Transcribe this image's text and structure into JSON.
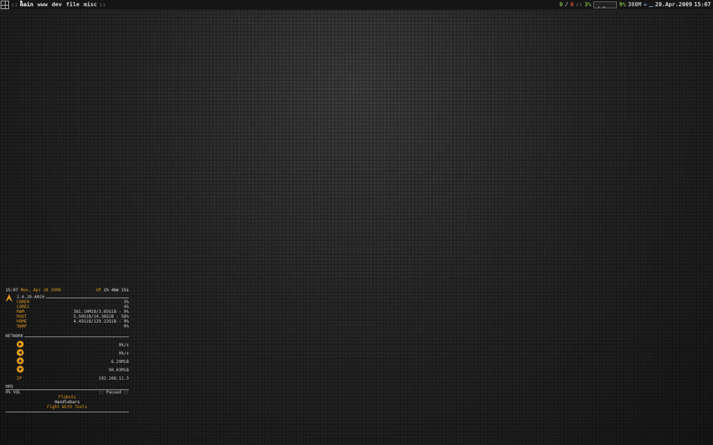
{
  "topbar": {
    "left_sep": "::",
    "tags": [
      {
        "label": "main",
        "active": true
      },
      {
        "label": "www",
        "active": false
      },
      {
        "label": "dev",
        "active": false
      },
      {
        "label": "file",
        "active": false
      },
      {
        "label": "misc",
        "active": false
      }
    ],
    "tags_end_sep": "::",
    "updates_a": "0",
    "slash": "/",
    "updates_b": "0",
    "sep2": "::",
    "cpu_percent": "3%",
    "mem_percent": "9%",
    "mem_used": "380M",
    "mem_sep": "=",
    "date": "20.Apr.2009",
    "time": "15:07"
  },
  "conky": {
    "time": "15:07",
    "date": "Mon, Apr 20 2009",
    "uptime_label": "UP",
    "uptime": "1h 46m 15s",
    "kernel": "2.6.29-ARCH",
    "stats": [
      {
        "label": "CORE0",
        "value": "3%"
      },
      {
        "label": "CORE1",
        "value": "4%"
      },
      {
        "label": "RAM",
        "value": "381.10MiB/3.85GiB - 9%"
      },
      {
        "label": "ROOT",
        "value": "5.50GiB/14.36GiB - 56%"
      },
      {
        "label": "HOME",
        "value": "4.45GiB/129.22GiB - 9%"
      },
      {
        "label": "SWAP",
        "value": "0%"
      }
    ],
    "network_title": "NETWORK",
    "network": [
      {
        "icon": "upload-speed-icon",
        "value": "0k/s"
      },
      {
        "icon": "download-speed-icon",
        "value": "0k/s"
      },
      {
        "icon": "total-up-icon",
        "value": "6.29MiB"
      },
      {
        "icon": "total-down-icon",
        "value": "90.03MiB"
      }
    ],
    "ip_label": "IP",
    "ip": "192.168.11.3",
    "mpd_title": "MPD",
    "volume": "0% VOL",
    "mpd_status": ":: Paused ::",
    "song_artist": "Flobots",
    "song_album": "Handlebars",
    "song_title": "Fight With Tools"
  },
  "colors": {
    "accent": "#e39a1c",
    "green": "#7fb241",
    "red": "#d34a3a"
  }
}
